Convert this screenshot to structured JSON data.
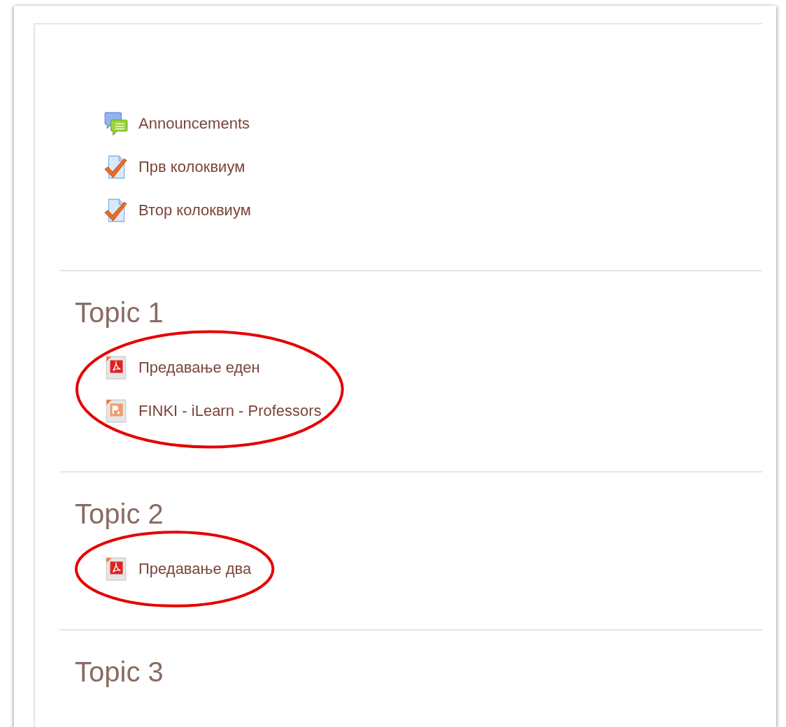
{
  "sections": [
    {
      "highlighted": false,
      "items": [
        {
          "kind": "forum",
          "label": "Announcements"
        },
        {
          "kind": "quiz",
          "label": "Прв колоквиум"
        },
        {
          "kind": "quiz",
          "label": "Втор колоквиум"
        }
      ]
    },
    {
      "title": "Topic 1",
      "highlighted": true,
      "items": [
        {
          "kind": "pdf",
          "label": "Предавање еден"
        },
        {
          "kind": "powerpoint",
          "label": "FINKI - iLearn - Professors"
        }
      ]
    },
    {
      "title": "Topic 2",
      "highlighted": true,
      "items": [
        {
          "kind": "pdf",
          "label": "Предавање два"
        }
      ]
    },
    {
      "title": "Topic 3",
      "highlighted": false
    }
  ]
}
